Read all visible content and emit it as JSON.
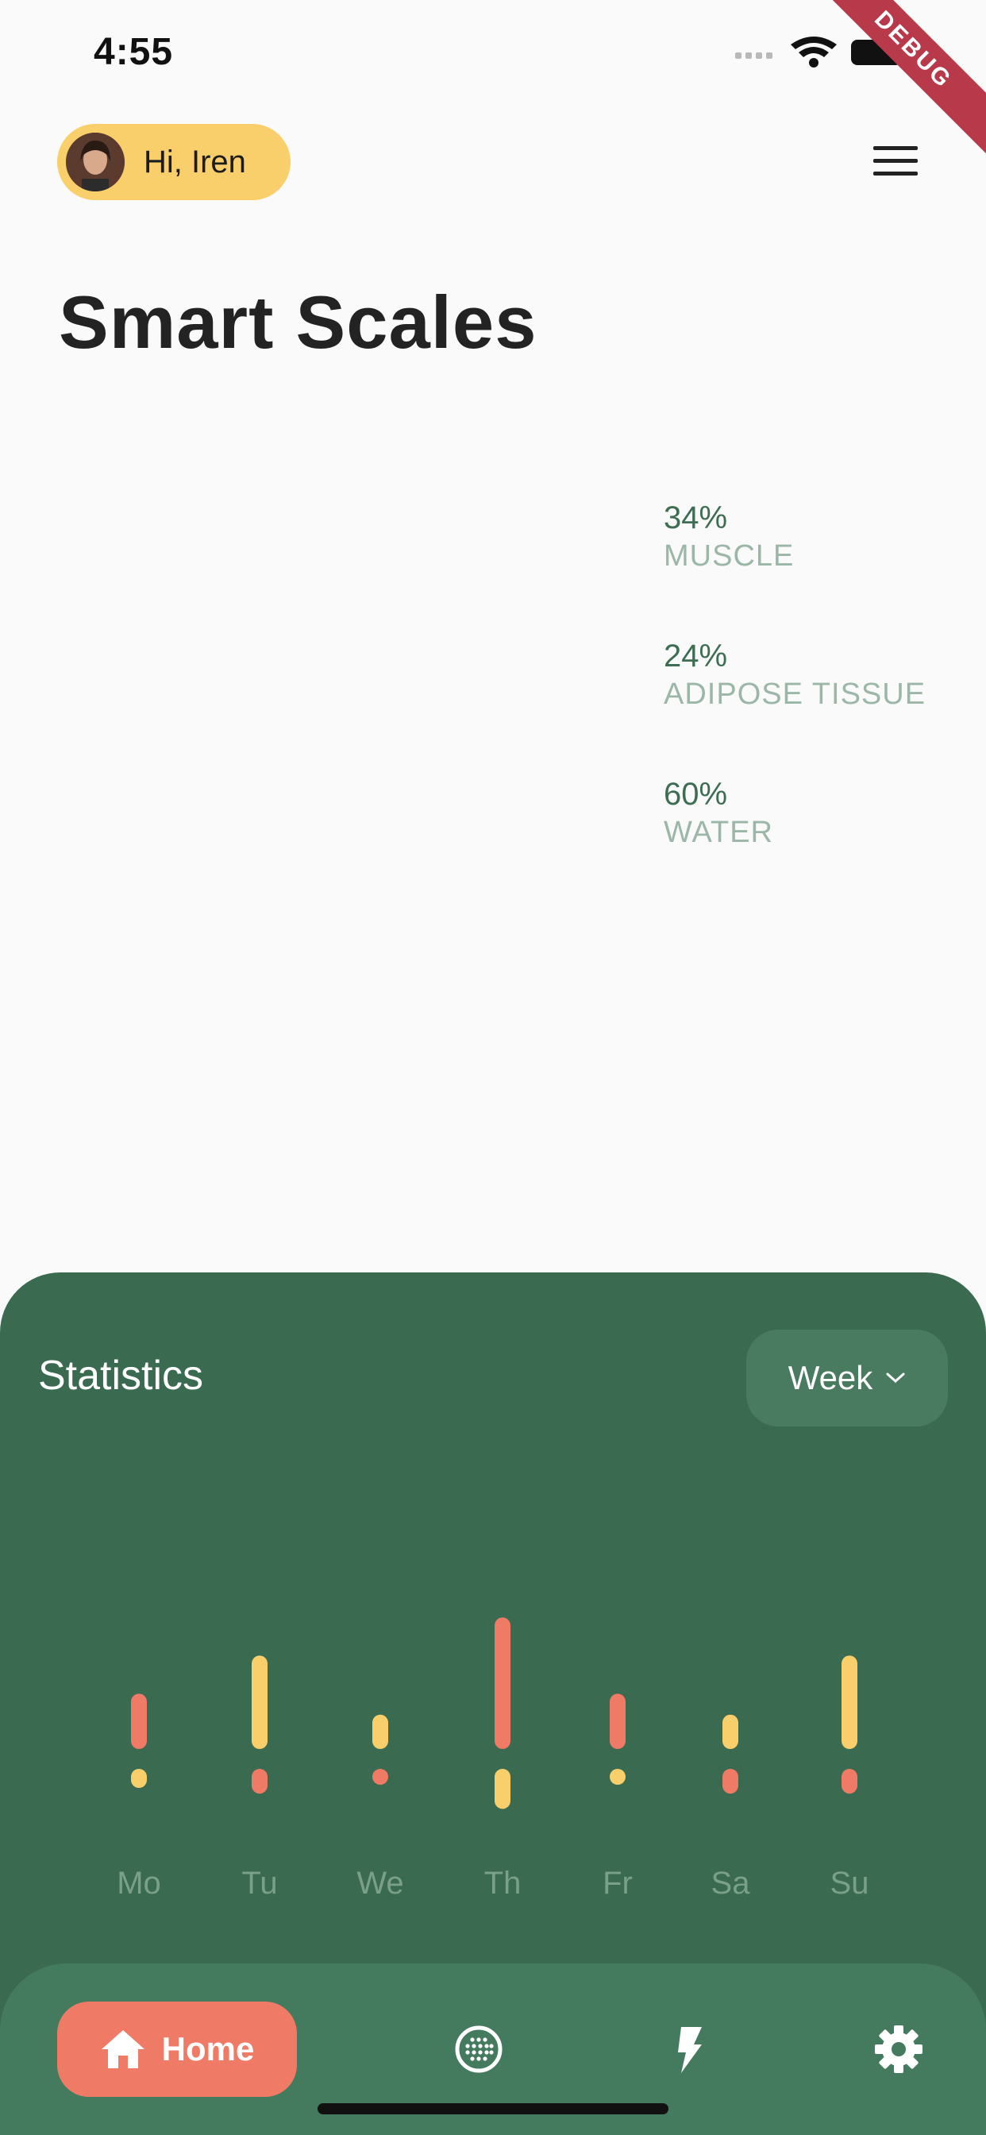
{
  "status_bar": {
    "time": "4:55"
  },
  "debug_banner": "DEBUG",
  "header": {
    "greeting": "Hi, Iren"
  },
  "page": {
    "title": "Smart Scales"
  },
  "metrics": [
    {
      "value": "34%",
      "label": "MUSCLE"
    },
    {
      "value": "24%",
      "label": "ADIPOSE TISSUE"
    },
    {
      "value": "60%",
      "label": "WATER"
    }
  ],
  "statistics": {
    "title": "Statistics",
    "period": "Week"
  },
  "colors": {
    "accent_coral": "#ef7a65",
    "accent_yellow": "#f9cf6b",
    "panel_green": "#3a6a50"
  },
  "chart_data": {
    "type": "bar",
    "categories": [
      "Mo",
      "Tu",
      "We",
      "Th",
      "Fr",
      "Sa",
      "Su"
    ],
    "series": [
      {
        "color": "#ef7a65",
        "upper": [
          1,
          0,
          0,
          1,
          1,
          0,
          0
        ]
      },
      {
        "values_upper": [
          0.29,
          0.49,
          0.18,
          0.69,
          0.29,
          0.18,
          0.49
        ],
        "values_lower": [
          0.1,
          0.13,
          0.07,
          0.21,
          0.07,
          0.13,
          0.13
        ]
      }
    ],
    "ylim": [
      0,
      1
    ]
  },
  "nav": {
    "home_label": "Home",
    "items": [
      {
        "icon": "home-icon"
      },
      {
        "icon": "grid-globe-icon"
      },
      {
        "icon": "bolt-icon"
      },
      {
        "icon": "gear-icon"
      }
    ]
  }
}
